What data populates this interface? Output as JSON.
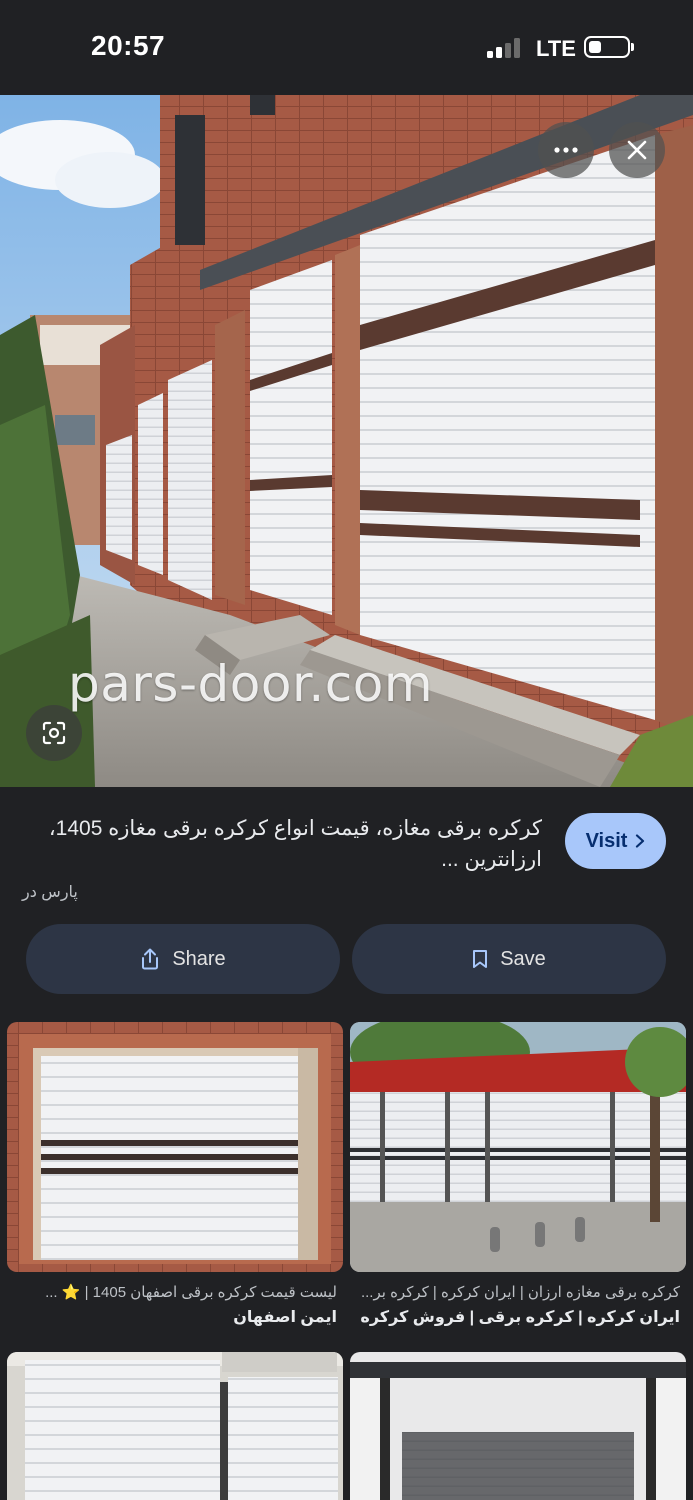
{
  "status_bar": {
    "time": "20:57",
    "network": "LTE"
  },
  "hero": {
    "watermark": "pars-door.com"
  },
  "result": {
    "title": "کرکره برقی مغازه، قیمت انواع کرکره برقی مغازه 1405، ارزانترین ...",
    "source": "پارس در",
    "visit_label": "Visit"
  },
  "actions": {
    "share_label": "Share",
    "save_label": "Save"
  },
  "related": [
    {
      "line1": "لیست قیمت کرکره برقی اصفهان 1405 | ⭐ ...",
      "line2": "ایمن اصفهان"
    },
    {
      "line1": "کرکره برقی مغازه ارزان | ایران کرکره | کرکره بر...",
      "line2": "ایران کرکره | کرکره برقی | فروش کرکره برقی..."
    },
    {
      "line1": "",
      "line2": ""
    },
    {
      "line1": "",
      "line2": ""
    }
  ],
  "colors": {
    "background": "#202124",
    "visit_button": "#a8c7fa",
    "action_button": "#2d3545"
  },
  "icons": [
    "more-icon",
    "close-icon",
    "lens-icon",
    "share-icon",
    "bookmark-icon",
    "chevron-right-icon"
  ]
}
